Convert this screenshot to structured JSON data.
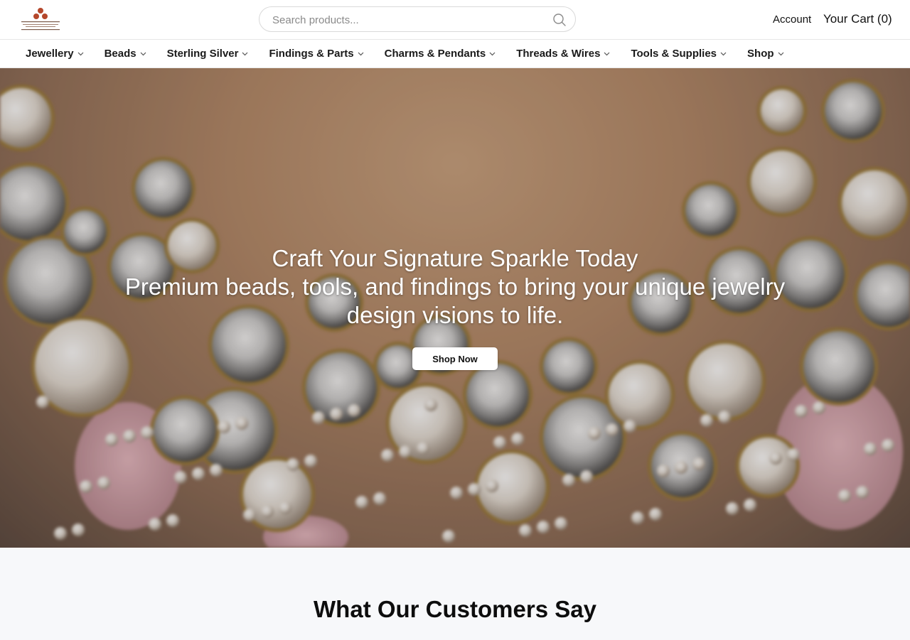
{
  "header": {
    "logo_name": "brand-logo",
    "search": {
      "placeholder": "Search products..."
    },
    "account_label": "Account",
    "cart_label": "Your Cart (0)"
  },
  "nav": {
    "items": [
      {
        "label": "Jewellery"
      },
      {
        "label": "Beads"
      },
      {
        "label": "Sterling Silver"
      },
      {
        "label": "Findings & Parts"
      },
      {
        "label": "Charms & Pendants"
      },
      {
        "label": "Threads & Wires"
      },
      {
        "label": "Tools & Supplies"
      },
      {
        "label": "Shop"
      }
    ]
  },
  "hero": {
    "title": "Craft Your Signature Sparkle Today",
    "subtitle": "Premium beads, tools, and findings to bring your unique jewelry design visions to life.",
    "cta_label": "Shop Now"
  },
  "testimonials": {
    "heading": "What Our Customers Say"
  },
  "colors": {
    "logo_accent": "#b5472b",
    "text": "#111111",
    "section_bg": "#f7f8fa"
  },
  "icons": [
    "search-icon",
    "chevron-down-icon"
  ]
}
